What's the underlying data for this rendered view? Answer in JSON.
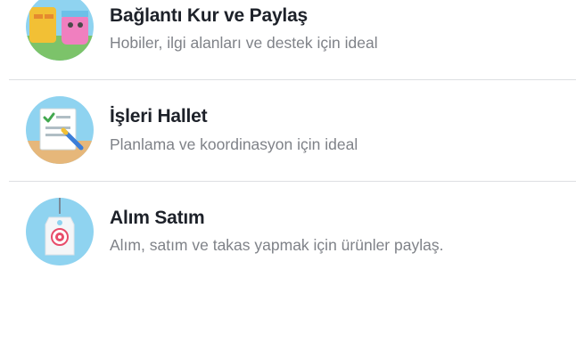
{
  "items": [
    {
      "title": "Bağlantı Kur ve Paylaş",
      "subtitle": "Hobiler, ilgi alanları ve destek için ideal",
      "icon": "connect-share-icon"
    },
    {
      "title": "İşleri Hallet",
      "subtitle": "Planlama ve koordinasyon için ideal",
      "icon": "checklist-icon"
    },
    {
      "title": "Alım Satım",
      "subtitle": "Alım, satım ve takas yapmak için ürünler paylaş.",
      "icon": "price-tag-icon"
    }
  ],
  "colors": {
    "title": "#1d2129",
    "subtitle": "#7f8288",
    "divider": "#dddfe2",
    "icon_bg_blue": "#8fd3f0"
  }
}
